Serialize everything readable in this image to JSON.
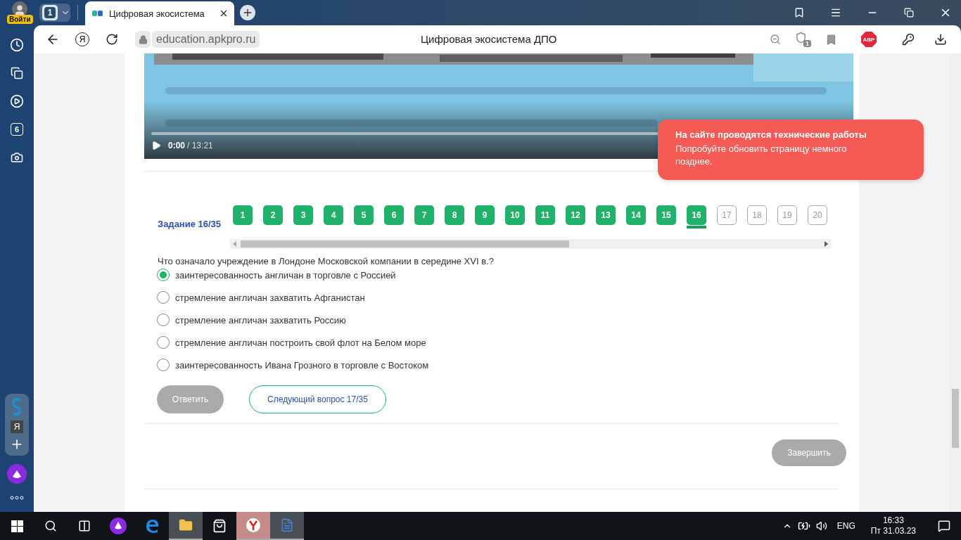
{
  "browser": {
    "profile_label": "Войти",
    "tab_count": "1",
    "tab_title": "Цифровая экосистема",
    "url": "education.apkpro.ru",
    "page_title": "Цифровая экосистема ДПО",
    "shield_badge": "1",
    "adblock_label": "ABP",
    "home_button_label": "Я"
  },
  "sidebar": {
    "badge": "6",
    "panel_letter": "Я"
  },
  "video": {
    "current_time": "0:00",
    "duration": "/ 13:21"
  },
  "tasks": {
    "label": "Задание 16/35",
    "items": [
      {
        "number": "1",
        "answered": true,
        "selected": false
      },
      {
        "number": "2",
        "answered": true,
        "selected": false
      },
      {
        "number": "3",
        "answered": true,
        "selected": false
      },
      {
        "number": "4",
        "answered": true,
        "selected": false
      },
      {
        "number": "5",
        "answered": true,
        "selected": false
      },
      {
        "number": "6",
        "answered": true,
        "selected": false
      },
      {
        "number": "7",
        "answered": true,
        "selected": false
      },
      {
        "number": "8",
        "answered": true,
        "selected": false
      },
      {
        "number": "9",
        "answered": true,
        "selected": false
      },
      {
        "number": "10",
        "answered": true,
        "selected": false
      },
      {
        "number": "11",
        "answered": true,
        "selected": false
      },
      {
        "number": "12",
        "answered": true,
        "selected": false
      },
      {
        "number": "13",
        "answered": true,
        "selected": false
      },
      {
        "number": "14",
        "answered": true,
        "selected": false
      },
      {
        "number": "15",
        "answered": true,
        "selected": false
      },
      {
        "number": "16",
        "answered": true,
        "selected": true
      },
      {
        "number": "17",
        "answered": false,
        "selected": false
      },
      {
        "number": "18",
        "answered": false,
        "selected": false
      },
      {
        "number": "19",
        "answered": false,
        "selected": false
      },
      {
        "number": "20",
        "answered": false,
        "selected": false
      }
    ]
  },
  "question": {
    "text": "Что означало учреждение в Лондоне Московской компании в середине XVI в.?",
    "options": [
      {
        "label": "заинтересованность англичан в торговле с Россией",
        "selected": true
      },
      {
        "label": "стремление англичан захватить Афганистан",
        "selected": false
      },
      {
        "label": "стремление англичан захватить Россию",
        "selected": false
      },
      {
        "label": "стремление англичан построить свой флот на Белом море",
        "selected": false
      },
      {
        "label": "заинтересованность Ивана Грозного в торговле с Востоком",
        "selected": false
      }
    ]
  },
  "actions": {
    "answer": {
      "label": "Ответить",
      "disabled": true
    },
    "next": {
      "label": "Следующий вопрос 17/35"
    },
    "finish": {
      "label": "Завершить"
    }
  },
  "toast": {
    "title": "На сайте проводятся технические работы",
    "message": "Попробуйте обновить страницу немного позднее."
  },
  "taskbar": {
    "language": "ENG",
    "time": "16:33",
    "date": "Пт 31.03.23"
  }
}
